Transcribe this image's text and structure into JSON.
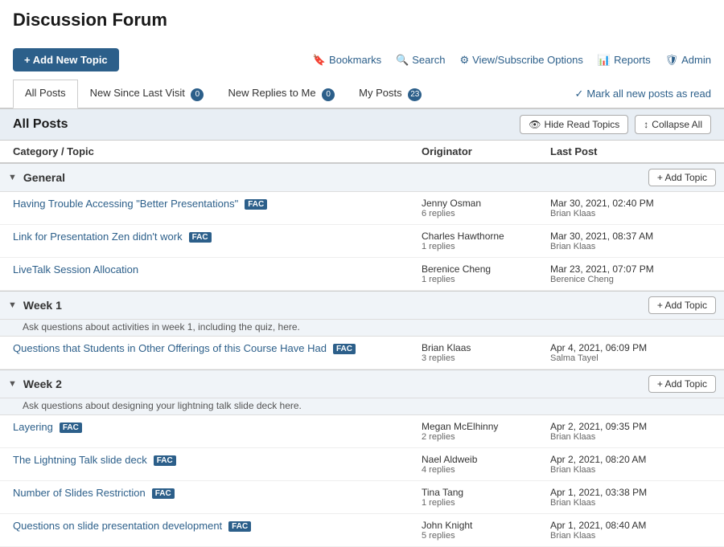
{
  "page": {
    "title": "Discussion Forum"
  },
  "toolbar": {
    "add_topic_label": "Add New Topic",
    "bookmarks_label": "Bookmarks",
    "search_label": "Search",
    "view_subscribe_label": "View/Subscribe Options",
    "reports_label": "Reports",
    "admin_label": "Admin"
  },
  "tabs": [
    {
      "id": "all-posts",
      "label": "All Posts",
      "badge": null,
      "active": true
    },
    {
      "id": "new-since",
      "label": "New Since Last Visit",
      "badge": "0",
      "active": false
    },
    {
      "id": "new-replies",
      "label": "New Replies to Me",
      "badge": "0",
      "active": false
    },
    {
      "id": "my-posts",
      "label": "My Posts",
      "badge": "23",
      "active": false
    }
  ],
  "mark_all_label": "Mark all new posts as read",
  "section": {
    "title": "All Posts",
    "hide_read_label": "Hide Read Topics",
    "collapse_all_label": "Collapse All"
  },
  "table_headers": {
    "category_topic": "Category / Topic",
    "originator": "Originator",
    "last_post": "Last Post"
  },
  "categories": [
    {
      "name": "General",
      "description": null,
      "topics": [
        {
          "title": "Having Trouble Accessing \"Better Presentations\"",
          "fac": true,
          "originator": "Jenny Osman",
          "replies": "6 replies",
          "last_post_date": "Mar 30, 2021, 02:40 PM",
          "last_post_by": "Brian Klaas"
        },
        {
          "title": "Link for Presentation Zen didn't work",
          "fac": true,
          "originator": "Charles Hawthorne",
          "replies": "1 replies",
          "last_post_date": "Mar 30, 2021, 08:37 AM",
          "last_post_by": "Brian Klaas"
        },
        {
          "title": "LiveTalk Session Allocation",
          "fac": false,
          "originator": "Berenice Cheng",
          "replies": "1 replies",
          "last_post_date": "Mar 23, 2021, 07:07 PM",
          "last_post_by": "Berenice Cheng"
        }
      ]
    },
    {
      "name": "Week 1",
      "description": "Ask questions about activities in week 1, including the quiz, here.",
      "topics": [
        {
          "title": "Questions that Students in Other Offerings of this Course Have Had",
          "fac": true,
          "originator": "Brian Klaas",
          "replies": "3 replies",
          "last_post_date": "Apr 4, 2021, 06:09 PM",
          "last_post_by": "Salma Tayel"
        }
      ]
    },
    {
      "name": "Week 2",
      "description": "Ask questions about designing your lightning talk slide deck here.",
      "topics": [
        {
          "title": "Layering",
          "fac": true,
          "originator": "Megan McElhinny",
          "replies": "2 replies",
          "last_post_date": "Apr 2, 2021, 09:35 PM",
          "last_post_by": "Brian Klaas"
        },
        {
          "title": "The Lightning Talk slide deck",
          "fac": true,
          "originator": "Nael Aldweib",
          "replies": "4 replies",
          "last_post_date": "Apr 2, 2021, 08:20 AM",
          "last_post_by": "Brian Klaas"
        },
        {
          "title": "Number of Slides Restriction",
          "fac": true,
          "originator": "Tina Tang",
          "replies": "1 replies",
          "last_post_date": "Apr 1, 2021, 03:38 PM",
          "last_post_by": "Brian Klaas"
        },
        {
          "title": "Questions on slide presentation development",
          "fac": true,
          "originator": "John Knight",
          "replies": "5 replies",
          "last_post_date": "Apr 1, 2021, 08:40 AM",
          "last_post_by": "Brian Klaas"
        }
      ]
    }
  ]
}
